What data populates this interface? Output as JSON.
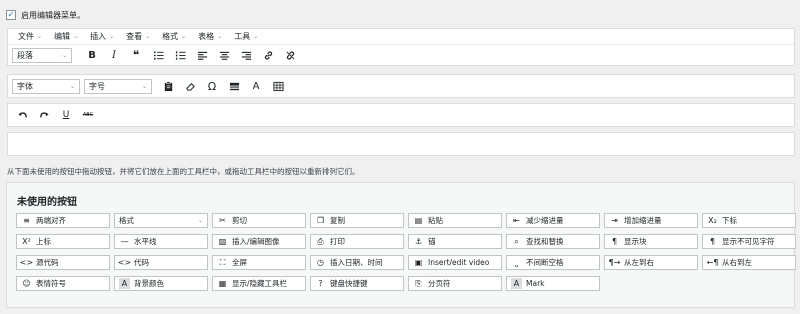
{
  "enable": {
    "checked": true,
    "label": "启用编辑器菜单。",
    "check_glyph": "✓"
  },
  "menubar": {
    "items": [
      "文件",
      "编辑",
      "插入",
      "查看",
      "格式",
      "表格",
      "工具"
    ],
    "chevron": "⌄"
  },
  "toolbar1": {
    "format_select": "段落",
    "buttons": [
      "bold-icon",
      "italic-icon",
      "blockquote-icon",
      "bulleted-list-icon",
      "numbered-list-icon",
      "align-left-icon",
      "align-center-icon",
      "align-right-icon",
      "link-icon",
      "unlink-icon"
    ],
    "bold_glyph": "B",
    "italic_glyph": "I",
    "quote_glyph": "❝"
  },
  "toolbar2": {
    "font_family_select": "字体",
    "font_size_select": "字号",
    "buttons": [
      "paste-icon",
      "eraser-icon",
      "special-char-icon",
      "hr-icon",
      "text-color-icon",
      "table-icon"
    ],
    "special_glyph": "Ω",
    "text_color_glyph": "A"
  },
  "toolbar3": {
    "buttons": [
      "undo-icon",
      "redo-icon",
      "underline-icon",
      "strikethrough-icon"
    ],
    "underline_glyph": "U",
    "strike_glyph": "ABC"
  },
  "instructions": "从下面未使用的按钮中拖动按钮，并将它们放在上面的工具栏中，或拖动工具栏中的按钮以重新排列它们。",
  "unused": {
    "title": "未使用的按钮",
    "items": [
      {
        "label": "两端对齐",
        "icon": "align-justify-icon",
        "glyph": "≡"
      },
      {
        "label": "格式",
        "icon": "",
        "glyph": "",
        "is_select": true
      },
      {
        "label": "剪切",
        "icon": "cut-icon",
        "glyph": "✂"
      },
      {
        "label": "复制",
        "icon": "copy-icon",
        "glyph": "❐"
      },
      {
        "label": "粘贴",
        "icon": "paste-icon",
        "glyph": "▤"
      },
      {
        "label": "减少缩进量",
        "icon": "outdent-icon",
        "glyph": "⇤"
      },
      {
        "label": "增加缩进量",
        "icon": "indent-icon",
        "glyph": "⇥"
      },
      {
        "label": "下标",
        "icon": "subscript-icon",
        "glyph": "X₂"
      },
      {
        "label": "上标",
        "icon": "superscript-icon",
        "glyph": "X²"
      },
      {
        "label": "水平线",
        "icon": "horizontal-line-icon",
        "glyph": "—"
      },
      {
        "label": "插入/编辑图像",
        "icon": "image-icon",
        "glyph": "▨"
      },
      {
        "label": "打印",
        "icon": "print-icon",
        "glyph": "⎙"
      },
      {
        "label": "锚",
        "icon": "anchor-icon",
        "glyph": "⚓"
      },
      {
        "label": "查找和替换",
        "icon": "search-replace-icon",
        "glyph": "⌕"
      },
      {
        "label": "显示块",
        "icon": "show-blocks-icon",
        "glyph": "¶"
      },
      {
        "label": "显示不可见字符",
        "icon": "pilcrow-icon",
        "glyph": "¶"
      },
      {
        "label": "源代码",
        "icon": "source-code-icon",
        "glyph": "<>"
      },
      {
        "label": "代码",
        "icon": "code-icon",
        "glyph": "<>"
      },
      {
        "label": "全屏",
        "icon": "fullscreen-icon",
        "glyph": "⛶"
      },
      {
        "label": "插入日期、时间",
        "icon": "clock-icon",
        "glyph": "◷"
      },
      {
        "label": "Insert/edit video",
        "icon": "video-icon",
        "glyph": "▣"
      },
      {
        "label": "不间断空格",
        "icon": "nbsp-icon",
        "glyph": "⎵"
      },
      {
        "label": "从左到右",
        "icon": "ltr-icon",
        "glyph": "¶→"
      },
      {
        "label": "从右到左",
        "icon": "rtl-icon",
        "glyph": "←¶"
      },
      {
        "label": "表情符号",
        "icon": "emoji-icon",
        "glyph": "☺"
      },
      {
        "label": "背景颜色",
        "icon": "background-color-icon",
        "glyph": "A"
      },
      {
        "label": "显示/隐藏工具栏",
        "icon": "toolbar-toggle-icon",
        "glyph": "▦"
      },
      {
        "label": "键盘快捷键",
        "icon": "keyboard-help-icon",
        "glyph": "?"
      },
      {
        "label": "分页符",
        "icon": "page-break-icon",
        "glyph": "⎘"
      },
      {
        "label": "Mark",
        "icon": "mark-icon",
        "glyph": "A"
      }
    ]
  }
}
